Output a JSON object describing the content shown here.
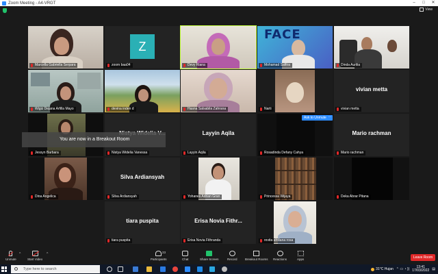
{
  "window": {
    "title": "Zoom Meeting - A4-VRGT",
    "minimize": "–",
    "maximize": "□",
    "close": "✕"
  },
  "view": {
    "label": "View"
  },
  "overlay": {
    "breakout_text": "You are now in a Breakout Room",
    "ask_unmute": "Ask to Unmute",
    "more": "···"
  },
  "tiles": [
    {
      "name": "Marcella Gabriella Serpara",
      "type": "video"
    },
    {
      "name": "zoom baa04",
      "type": "avatar",
      "initial": "Z"
    },
    {
      "name": "Devy Riana",
      "type": "video",
      "speaking": true
    },
    {
      "name": "Mohamad Safitra",
      "type": "video"
    },
    {
      "name": "Dinda Aurilia",
      "type": "video"
    },
    {
      "name": "Wigiz Dejana Arfilla Mayo",
      "type": "video"
    },
    {
      "name": "devina inden d",
      "type": "video"
    },
    {
      "name": "Hasna Salsabila Zahrana",
      "type": "video"
    },
    {
      "name": "Narti",
      "type": "video"
    },
    {
      "name": "vivian metta",
      "type": "name",
      "display": "vivian metta"
    },
    {
      "name": "Jessyn Barbara",
      "type": "video"
    },
    {
      "name": "Nistya Widelia Vanessa",
      "type": "name",
      "display": "Nistya Widelia V..."
    },
    {
      "name": "Layyin Aqila",
      "type": "name",
      "display": "Layyin Aqila"
    },
    {
      "name": "Rosadinda Defany Cahya",
      "type": "video"
    },
    {
      "name": "Mario rachman",
      "type": "name",
      "display": "Mario rachman"
    },
    {
      "name": "Dina Angelica",
      "type": "video"
    },
    {
      "name": "Silva Ardiansyah",
      "type": "name",
      "display": "Silva Ardiansyah"
    },
    {
      "name": "Yohanes Adrian Gran",
      "type": "video"
    },
    {
      "name": "Princessa Wijaya",
      "type": "video"
    },
    {
      "name": "Deka Abrar Pitana",
      "type": "video"
    },
    {
      "name": "tiara puspita",
      "type": "name",
      "display": "tiara puspita"
    },
    {
      "name": "Erisa Novia Fithranda",
      "type": "name",
      "display": "Erisa Novia Fithr..."
    },
    {
      "name": "revita afriliana rosa",
      "type": "video"
    }
  ],
  "toolbar": {
    "unmute": "Unmute",
    "start_video": "Start Video",
    "participants": "Participants",
    "participants_count": "23",
    "chat": "Chat",
    "share_screen": "Share Screen",
    "record": "Record",
    "breakout_rooms": "Breakout Rooms",
    "reactions": "Reactions",
    "apps": "Apps",
    "leave": "Leave Room"
  },
  "taskbar": {
    "search_placeholder": "Type here to search",
    "weather": "31°C Hujan",
    "time": "13:41",
    "date": "17/03/2022"
  }
}
